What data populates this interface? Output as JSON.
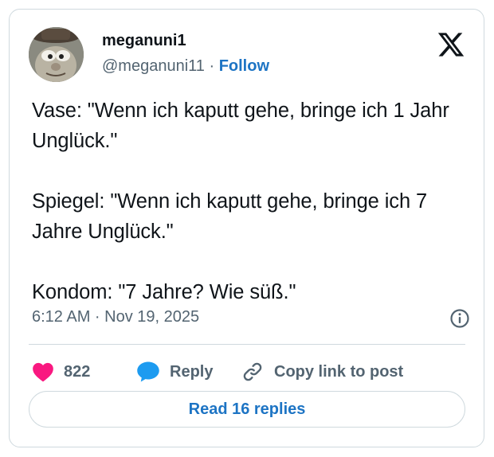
{
  "author": {
    "name": "meganuni1",
    "handle": "@meganuni11",
    "separator": " · ",
    "follow_label": "Follow"
  },
  "post": {
    "text": "Vase: \"Wenn ich kaputt gehe, bringe ich 1 Jahr Unglück.\"\n\nSpiegel: \"Wenn ich kaputt gehe, bringe ich 7 Jahre Unglück.\"\n\nKondom: \"7 Jahre? Wie süß.\"",
    "timestamp": "6:12 AM · Nov 19, 2025"
  },
  "actions": {
    "like_count": "822",
    "reply_label": "Reply",
    "copy_link_label": "Copy link to post"
  },
  "footer": {
    "read_replies_label": "Read 16 replies"
  },
  "icons": {
    "logo": "x-logo-icon",
    "info": "info-icon",
    "like": "heart-icon",
    "reply": "speech-bubble-icon",
    "copy": "link-icon"
  },
  "colors": {
    "like": "#f91880",
    "reply": "#1d9bf0",
    "link": "#1d74c4",
    "secondary_text": "#536471",
    "border": "#cfd9de"
  }
}
